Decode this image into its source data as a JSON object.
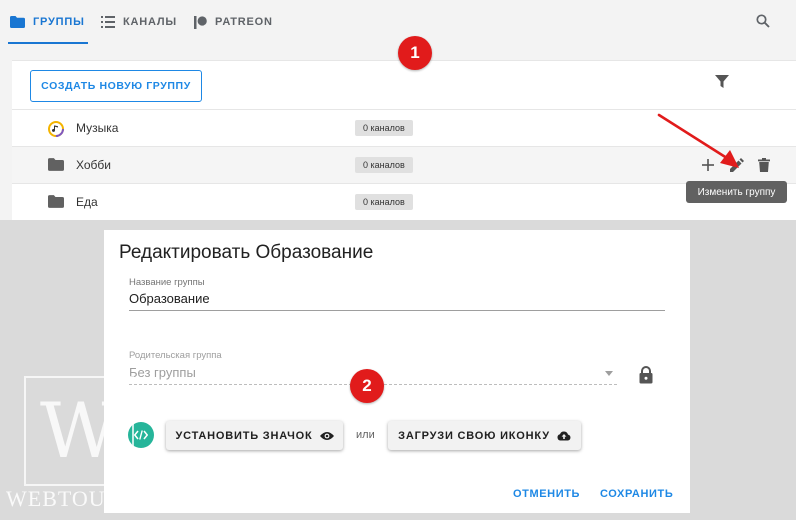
{
  "tabs": [
    {
      "label": "ГРУППЫ",
      "icon": "folder-icon",
      "active": true
    },
    {
      "label": "КАНАЛЫ",
      "icon": "list-icon",
      "active": false
    },
    {
      "label": "PATREON",
      "icon": "patreon-icon",
      "active": false
    }
  ],
  "toolbar": {
    "search_icon": "search-icon"
  },
  "groups_panel": {
    "create_button": "СОЗДАТЬ НОВУЮ ГРУППУ",
    "filter_icon": "filter-icon",
    "rows": [
      {
        "name": "Музыка",
        "count": "0 каналов",
        "icon": "music-icon"
      },
      {
        "name": "Хобби",
        "count": "0 каналов",
        "icon": "folder-icon"
      },
      {
        "name": "Еда",
        "count": "0 каналов",
        "icon": "folder-icon"
      }
    ],
    "row_actions": {
      "add_icon": "plus-icon",
      "edit_icon": "pencil-icon",
      "delete_icon": "trash-icon"
    },
    "tooltip": "Изменить группу"
  },
  "annotations": {
    "badge1": "1",
    "badge2": "2"
  },
  "dialog": {
    "title": "Редактировать Образование",
    "name_label": "Название группы",
    "name_value": "Образование",
    "parent_label": "Родительская группа",
    "parent_value": "Без группы",
    "set_icon_button": "УСТАНОВИТЬ ЗНАЧОК",
    "or_text": "или",
    "upload_button": "ЗАГРУЗИ СВОЮ ИКОНКУ",
    "cancel_button": "ОТМЕНИТЬ",
    "save_button": "СОХРАНИТЬ"
  },
  "watermark": {
    "letter": "W",
    "text": "WEBTOUS.RU"
  },
  "colors": {
    "accent": "#1e88e5",
    "badge": "#e11b1b",
    "code_icon": "#26b59a",
    "arrow": "#e11b1b"
  }
}
